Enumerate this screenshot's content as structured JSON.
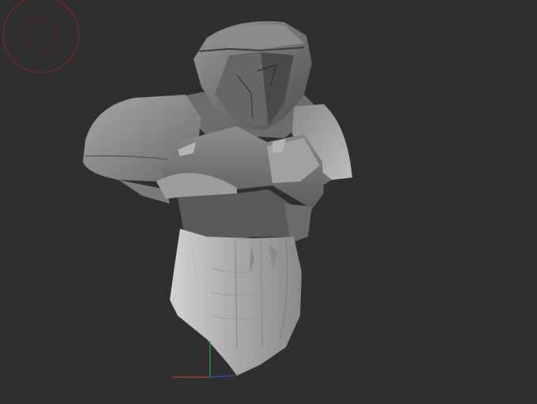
{
  "viewport": {
    "background": "#2f2f2f",
    "model": "armored-bust-sculpt",
    "colors": {
      "compass": "#7a2a2a",
      "axis_x": "#c03030",
      "axis_y": "#30a040",
      "axis_z": "#3050c0",
      "mesh_light": "#bdbdbd",
      "mesh_mid": "#8e8e8e",
      "mesh_dark": "#5e5e5e"
    }
  }
}
